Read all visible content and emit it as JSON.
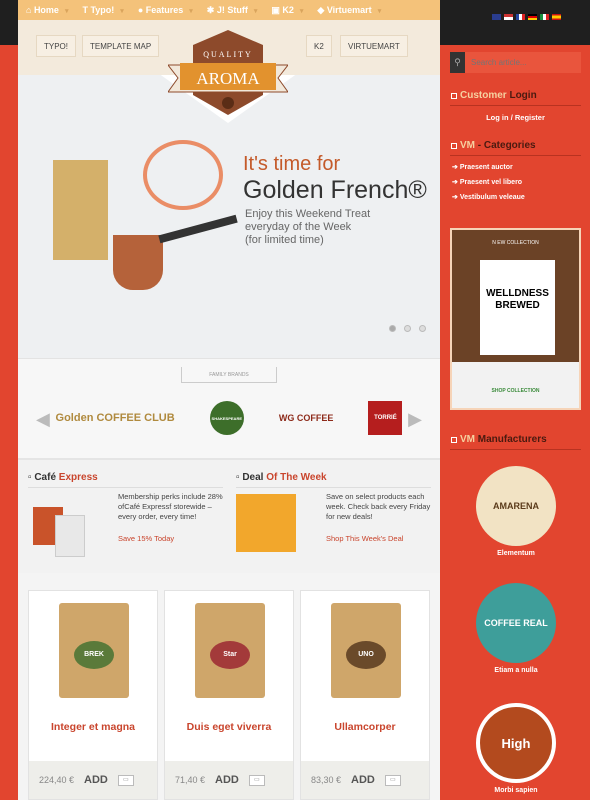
{
  "nav": {
    "items": [
      {
        "label": "Home",
        "icon": "home-icon"
      },
      {
        "label": "Typo!",
        "icon": "text-icon"
      },
      {
        "label": "Features",
        "icon": "bulb-icon"
      },
      {
        "label": "J! Stuff",
        "icon": "joomla-icon"
      },
      {
        "label": "K2",
        "icon": "image-icon"
      },
      {
        "label": "Virtuemart",
        "icon": "tag-icon"
      }
    ]
  },
  "header": {
    "buttons": [
      "TYPO!",
      "TEMPLATE MAP",
      "K2",
      "VIRTUEMART"
    ],
    "logo": {
      "top": "QUALITY",
      "main": "AROMA"
    }
  },
  "slider": {
    "title_line1": "It's time for",
    "title_line2": "Golden French®",
    "subtitle": [
      "Enjoy this Weekend Treat",
      "everyday of the Week",
      "(for limited time)"
    ],
    "slides": 3,
    "active": 0
  },
  "brands": {
    "label": "FAMILY BRANDS",
    "items": [
      "Golden COFFEE CLUB",
      "SHAKESPEARE",
      "WG COFFEE",
      "TORRIÉ"
    ]
  },
  "promo": [
    {
      "title_a": "Café",
      "title_b": "Express",
      "text": "Membership perks include 28% ofCafé Expressf storewide – every order, every time!",
      "link": "Save 15% Today"
    },
    {
      "title_a": "Deal",
      "title_b": "Of The Week",
      "text": "Save on select products each week. Check back every Friday for new deals!",
      "link": "Shop This Week's Deal"
    }
  ],
  "products": [
    {
      "name": "Integer et magna",
      "price": "224,40 €",
      "label": "BREK"
    },
    {
      "name": "Duis eget viverra",
      "price": "71,40 €",
      "label": "Star"
    },
    {
      "name": "Ullamcorper",
      "price": "83,30 €",
      "label": "UNO"
    }
  ],
  "add_label": "ADD",
  "sidebar": {
    "search_placeholder": "Search article...",
    "login": {
      "title_a": "Customer",
      "title_b": "Login",
      "login": "Log in",
      "sep": "/",
      "register": "Register"
    },
    "categories": {
      "title_a": "VM",
      "title_b": "- Categories",
      "items": [
        "Praesent auctor",
        "Praesent vel libero",
        "Vestibulum veleaue"
      ]
    },
    "ad": {
      "top": "N EW COLLECTION",
      "line1": "WELLDNESS",
      "line2": "BREWED",
      "bottom": "SHOP COLLECTION"
    },
    "manufacturers": {
      "title_a": "VM",
      "title_b": "Manufacturers",
      "items": [
        {
          "name": "Elementum",
          "badge": "AMARENA"
        },
        {
          "name": "Etiam a nulla",
          "badge": "COFFEE REAL"
        },
        {
          "name": "Morbi sapien",
          "badge": "High"
        }
      ]
    }
  },
  "colors": {
    "accent": "#e2452f",
    "nav": "#f4c27a",
    "link": "#c9452d"
  }
}
